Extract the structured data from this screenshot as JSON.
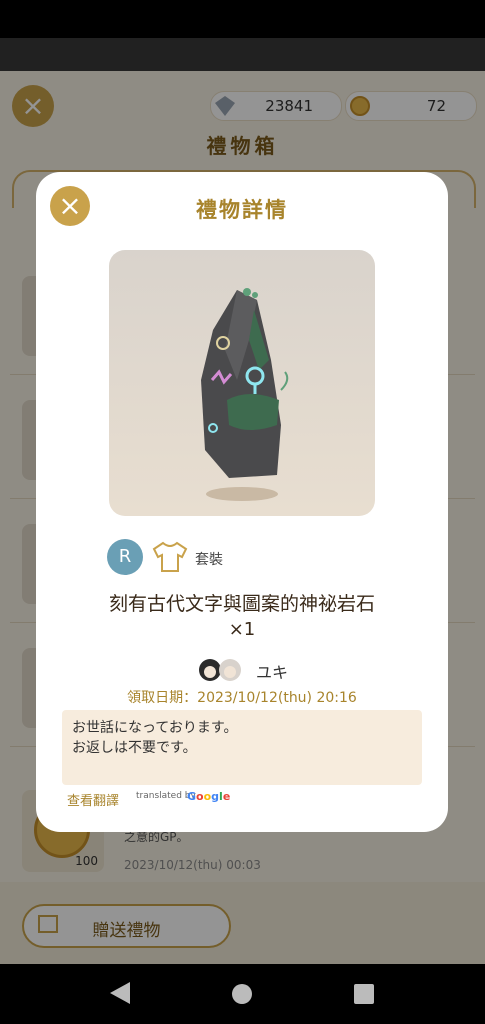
{
  "header": {
    "close_icon": "close-icon",
    "diamonds": "23841",
    "coins": "72",
    "title": "禮物箱"
  },
  "background_list": {
    "coin_item_count": "100",
    "coin_item_text": "之意的GP。",
    "coin_item_date": "2023/10/12(thu) 00:03"
  },
  "footer": {
    "send_gift_label": "贈送禮物"
  },
  "modal": {
    "title": "禮物詳情",
    "rarity": "R",
    "category": "套裝",
    "item_name": "刻有古代文字與圖案的神祕岩石",
    "quantity": "×1",
    "sender_name": "ユキ",
    "received_date": "領取日期：2023/10/12(thu) 20:16",
    "message_line1": "お世話になっております。",
    "message_line2": "お返しは不要です。",
    "translate_link": "查看翻譯",
    "translated_by": "translated by",
    "google": "Google"
  },
  "colors": {
    "accent": "#c9a24b",
    "rarity_badge": "#6a9fb5"
  }
}
